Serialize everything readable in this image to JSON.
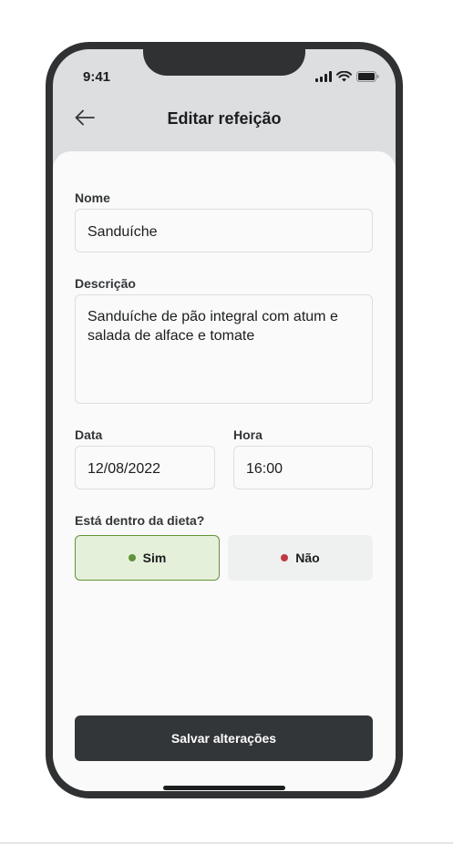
{
  "status_bar": {
    "time": "9:41"
  },
  "header": {
    "title": "Editar refeição"
  },
  "form": {
    "name_label": "Nome",
    "name_value": "Sanduíche",
    "description_label": "Descrição",
    "description_value": "Sanduíche de pão integral com atum e salada de alface e tomate",
    "date_label": "Data",
    "date_value": "12/08/2022",
    "time_label": "Hora",
    "time_value": "16:00",
    "diet_question": "Está dentro da dieta?",
    "diet_options": [
      {
        "label": "Sim",
        "color": "#639339",
        "selected": true
      },
      {
        "label": "Não",
        "color": "#bf3b44",
        "selected": false
      }
    ]
  },
  "actions": {
    "save_label": "Salvar alterações"
  },
  "colors": {
    "dark": "#333638",
    "green_bg": "#e5f0db",
    "green": "#639339",
    "red": "#bf3b44"
  }
}
